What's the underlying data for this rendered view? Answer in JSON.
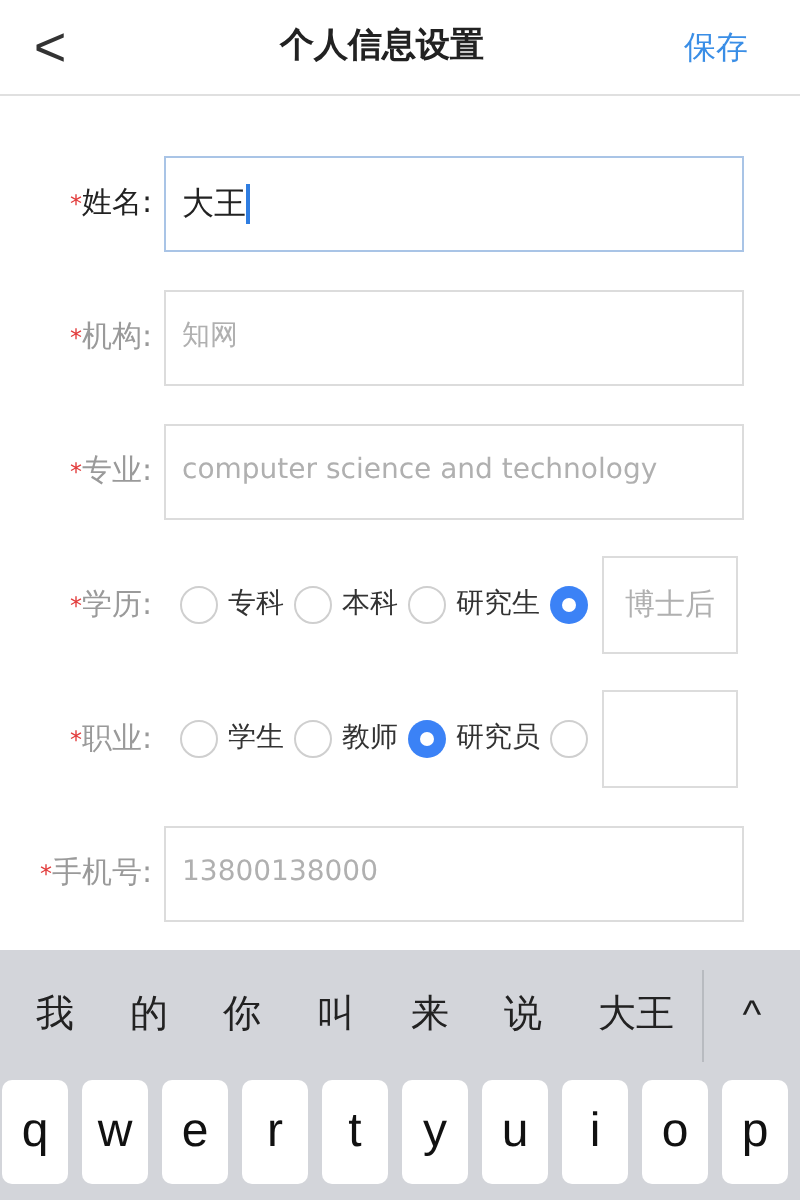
{
  "header": {
    "back": "<",
    "title": "个人信息设置",
    "save": "保存"
  },
  "fields": [
    {
      "kind": "input",
      "required": "*",
      "label": "姓名:",
      "focused": true,
      "value": "大王"
    },
    {
      "kind": "input",
      "required": "*",
      "label": "机构:",
      "focused": false,
      "placeholder": "知网"
    },
    {
      "kind": "input",
      "required": "*",
      "label": "专业:",
      "focused": false,
      "placeholder": "computer science and technology"
    },
    {
      "kind": "radio",
      "required": "*",
      "label": "学历:",
      "focused": false,
      "options": [
        {
          "kind": "text",
          "label": "专科",
          "selected": false
        },
        {
          "kind": "text",
          "label": "本科",
          "selected": false
        },
        {
          "kind": "text",
          "label": "研究生",
          "selected": false
        },
        {
          "kind": "other",
          "selected": true,
          "placeholder": "博士后"
        }
      ]
    },
    {
      "kind": "radio",
      "required": "*",
      "label": "职业:",
      "focused": false,
      "options": [
        {
          "kind": "text",
          "label": "学生",
          "selected": false
        },
        {
          "kind": "text",
          "label": "教师",
          "selected": false
        },
        {
          "kind": "text",
          "label": "研究员",
          "selected": true
        },
        {
          "kind": "other",
          "selected": false
        }
      ]
    },
    {
      "kind": "input",
      "required": "*",
      "label": "手机号:",
      "focused": false,
      "placeholder": "13800138000"
    }
  ],
  "keyboard": {
    "candidates": [
      "我",
      "的",
      "你",
      "叫",
      "来",
      "说",
      "大王"
    ],
    "expand": "^",
    "keys": [
      "q",
      "w",
      "e",
      "r",
      "t",
      "y",
      "u",
      "i",
      "o",
      "p"
    ]
  }
}
